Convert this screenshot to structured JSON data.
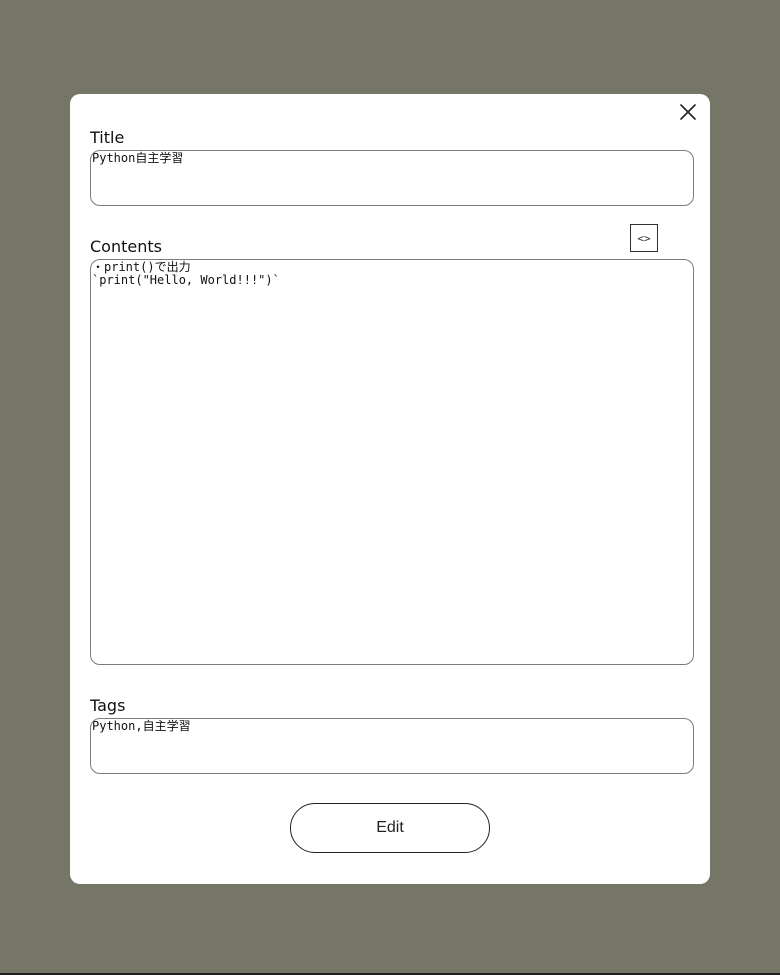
{
  "form": {
    "title_label": "Title",
    "title_value": "Python自主学習",
    "contents_label": "Contents",
    "contents_value": "・print()で出力\n`print(\"Hello, World!!!\")`",
    "code_toggle_label": "<>",
    "tags_label": "Tags",
    "tags_value": "Python,自主学習",
    "edit_label": "Edit"
  },
  "icons": {
    "close": "close-icon"
  },
  "colors": {
    "backdrop": "#767668",
    "modal": "#ffffff",
    "border": "#7c7c7c",
    "text": "#111111"
  }
}
